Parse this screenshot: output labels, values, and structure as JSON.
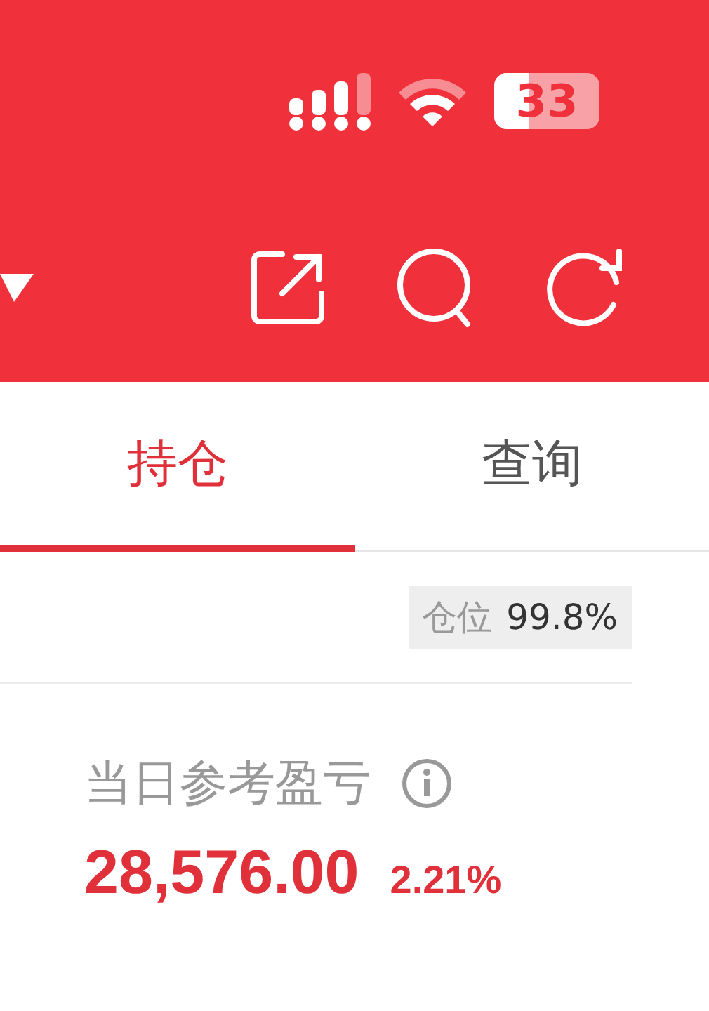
{
  "status_bar": {
    "battery": "33"
  },
  "tabs": [
    {
      "label": "持仓",
      "selected": true
    },
    {
      "label": "查询",
      "selected": false
    }
  ],
  "position_badge": {
    "label": "仓位",
    "value": "99.8%"
  },
  "daily_pnl": {
    "label": "当日参考盈亏",
    "amount": "28,576.00",
    "percent": "2.21%"
  }
}
